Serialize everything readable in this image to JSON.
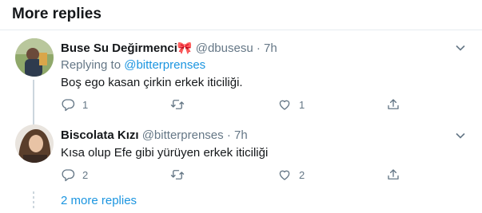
{
  "header": {
    "title": "More replies"
  },
  "tweets": [
    {
      "name": "Buse Su Değirmenci🎀",
      "handle": "@dbusesu",
      "separator": "·",
      "time": "7h",
      "replying_prefix": "Replying to",
      "replying_mention": "@bitterprenses",
      "text": "Boş ego kasan çirkin erkek iticiliği.",
      "reply_count": "1",
      "retweet_count": "",
      "like_count": "1"
    },
    {
      "name": "Biscolata Kızı",
      "handle": "@bitterprenses",
      "separator": "·",
      "time": "7h",
      "text": "Kısa olup Efe gibi yürüyen erkek iticiliği",
      "reply_count": "2",
      "retweet_count": "",
      "like_count": "2"
    }
  ],
  "more_replies": "2 more replies",
  "icons": {
    "reply": "reply-icon",
    "retweet": "retweet-icon",
    "like": "like-icon",
    "share": "share-icon",
    "caret": "chevron-down-icon"
  },
  "colors": {
    "link": "#1b95e0",
    "muted": "#657786",
    "divider": "#e6ecf0",
    "thread": "#ccd6dd"
  }
}
